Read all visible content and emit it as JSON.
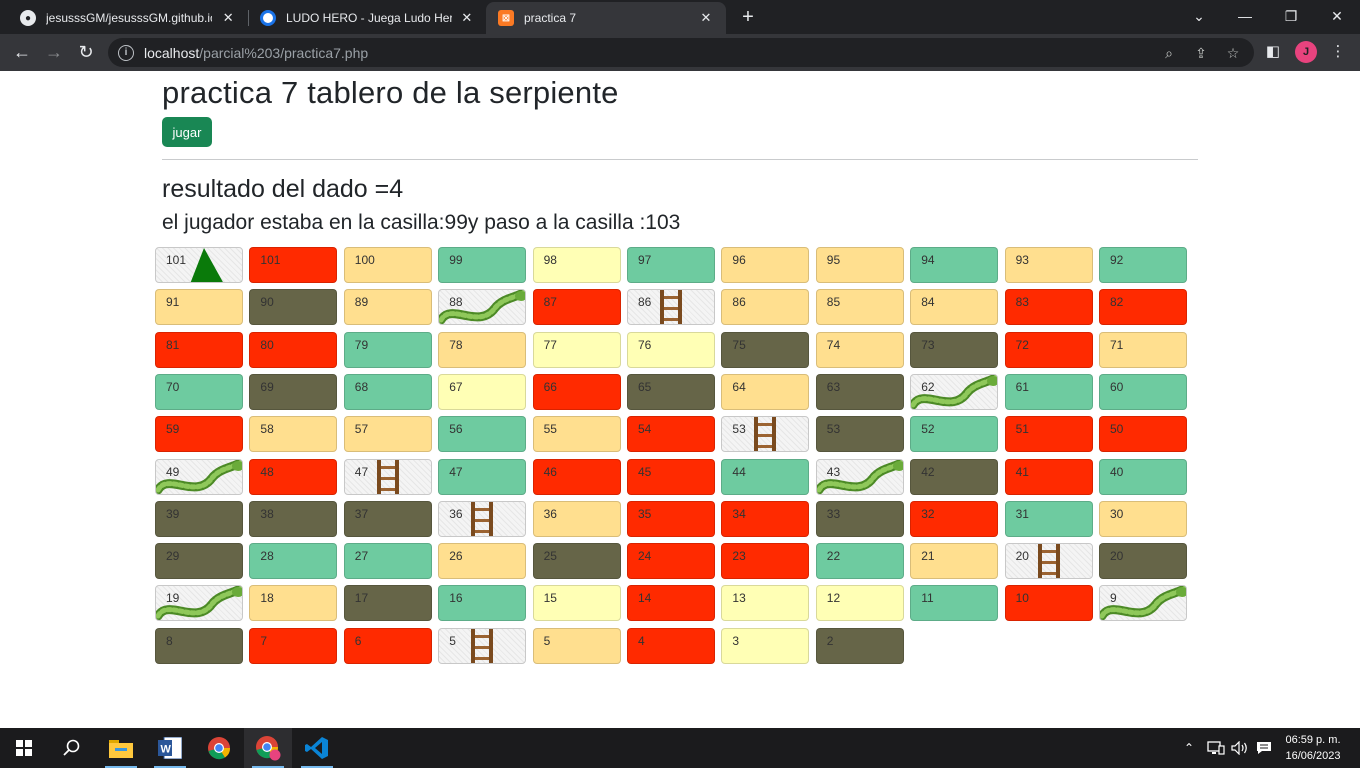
{
  "browser": {
    "tabs": [
      {
        "title": "jesusssGM/jesusssGM.github.io",
        "icon": "github-icon"
      },
      {
        "title": "LUDO HERO - Juega Ludo Hero e",
        "icon": "ludo-hero-icon"
      },
      {
        "title": "practica 7",
        "icon": "xampp-icon",
        "active": true
      }
    ],
    "url_host": "localhost",
    "url_path": "/parcial%203/practica7.php",
    "profile_initial": "J"
  },
  "page": {
    "title": "practica 7 tablero de la serpiente",
    "button_label": "jugar",
    "result_text": "resultado del dado =4",
    "move_text": "el jugador estaba en la casilla:99y paso a la casilla :103"
  },
  "colors": {
    "red": "#ff2a00",
    "orange": "#ffdf8f",
    "yellow": "#ffffb5",
    "green": "#6ecba0",
    "olive": "#666548",
    "special": "#f4f4f4",
    "button": "#198754"
  },
  "board": {
    "rows": [
      [
        [
          "101",
          "special",
          "tree"
        ],
        [
          "101",
          "red"
        ],
        [
          "100",
          "orange"
        ],
        [
          "99",
          "green"
        ],
        [
          "98",
          "yellow"
        ],
        [
          "97",
          "green"
        ],
        [
          "96",
          "orange"
        ],
        [
          "95",
          "orange"
        ],
        [
          "94",
          "green"
        ],
        [
          "93",
          "orange"
        ],
        [
          "92",
          "green"
        ]
      ],
      [
        [
          "91",
          "orange"
        ],
        [
          "90",
          "olive"
        ],
        [
          "89",
          "orange"
        ],
        [
          "88",
          "special",
          "snake"
        ],
        [
          "87",
          "red"
        ],
        [
          "86",
          "special",
          "ladder"
        ],
        [
          "86",
          "orange"
        ],
        [
          "85",
          "orange"
        ],
        [
          "84",
          "orange"
        ],
        [
          "83",
          "red"
        ],
        [
          "82",
          "red"
        ]
      ],
      [
        [
          "81",
          "red"
        ],
        [
          "80",
          "red"
        ],
        [
          "79",
          "green"
        ],
        [
          "78",
          "orange"
        ],
        [
          "77",
          "yellow"
        ],
        [
          "76",
          "yellow"
        ],
        [
          "75",
          "olive"
        ],
        [
          "74",
          "orange"
        ],
        [
          "73",
          "olive"
        ],
        [
          "72",
          "red"
        ],
        [
          "71",
          "orange"
        ]
      ],
      [
        [
          "70",
          "green"
        ],
        [
          "69",
          "olive"
        ],
        [
          "68",
          "green"
        ],
        [
          "67",
          "yellow"
        ],
        [
          "66",
          "red"
        ],
        [
          "65",
          "olive"
        ],
        [
          "64",
          "orange"
        ],
        [
          "63",
          "olive"
        ],
        [
          "62",
          "special",
          "snake"
        ],
        [
          "61",
          "green"
        ],
        [
          "60",
          "green"
        ]
      ],
      [
        [
          "59",
          "red"
        ],
        [
          "58",
          "orange"
        ],
        [
          "57",
          "orange"
        ],
        [
          "56",
          "green"
        ],
        [
          "55",
          "orange"
        ],
        [
          "54",
          "red"
        ],
        [
          "53",
          "special",
          "ladder"
        ],
        [
          "53",
          "olive"
        ],
        [
          "52",
          "green"
        ],
        [
          "51",
          "red"
        ],
        [
          "50",
          "red"
        ]
      ],
      [
        [
          "49",
          "special",
          "snake"
        ],
        [
          "48",
          "red"
        ],
        [
          "47",
          "special",
          "ladder"
        ],
        [
          "47",
          "green"
        ],
        [
          "46",
          "red"
        ],
        [
          "45",
          "red"
        ],
        [
          "44",
          "green"
        ],
        [
          "43",
          "special",
          "snake"
        ],
        [
          "42",
          "olive"
        ],
        [
          "41",
          "red"
        ],
        [
          "40",
          "green"
        ]
      ],
      [
        [
          "39",
          "olive"
        ],
        [
          "38",
          "olive"
        ],
        [
          "37",
          "olive"
        ],
        [
          "36",
          "special",
          "ladder"
        ],
        [
          "36",
          "orange"
        ],
        [
          "35",
          "red"
        ],
        [
          "34",
          "red"
        ],
        [
          "33",
          "olive"
        ],
        [
          "32",
          "red"
        ],
        [
          "31",
          "green"
        ],
        [
          "30",
          "orange"
        ]
      ],
      [
        [
          "29",
          "olive"
        ],
        [
          "28",
          "green"
        ],
        [
          "27",
          "green"
        ],
        [
          "26",
          "orange"
        ],
        [
          "25",
          "olive"
        ],
        [
          "24",
          "red"
        ],
        [
          "23",
          "red"
        ],
        [
          "22",
          "green"
        ],
        [
          "21",
          "orange"
        ],
        [
          "20",
          "special",
          "ladder"
        ],
        [
          "20",
          "olive"
        ]
      ],
      [
        [
          "19",
          "special",
          "snake"
        ],
        [
          "18",
          "orange"
        ],
        [
          "17",
          "olive"
        ],
        [
          "16",
          "green"
        ],
        [
          "15",
          "yellow"
        ],
        [
          "14",
          "red"
        ],
        [
          "13",
          "yellow"
        ],
        [
          "12",
          "yellow"
        ],
        [
          "11",
          "green"
        ],
        [
          "10",
          "red"
        ],
        [
          "9",
          "special",
          "snake"
        ]
      ],
      [
        [
          "8",
          "olive"
        ],
        [
          "7",
          "red"
        ],
        [
          "6",
          "red"
        ],
        [
          "5",
          "special",
          "ladder"
        ],
        [
          "5",
          "orange"
        ],
        [
          "4",
          "red"
        ],
        [
          "3",
          "yellow"
        ],
        [
          "2",
          "olive"
        ]
      ]
    ]
  },
  "taskbar": {
    "apps": [
      "start-icon",
      "search-icon",
      "file-explorer-icon",
      "word-icon",
      "chrome-icon",
      "chrome-profile-icon",
      "vscode-icon"
    ],
    "time": "06:59 p. m.",
    "date": "16/06/2023"
  }
}
